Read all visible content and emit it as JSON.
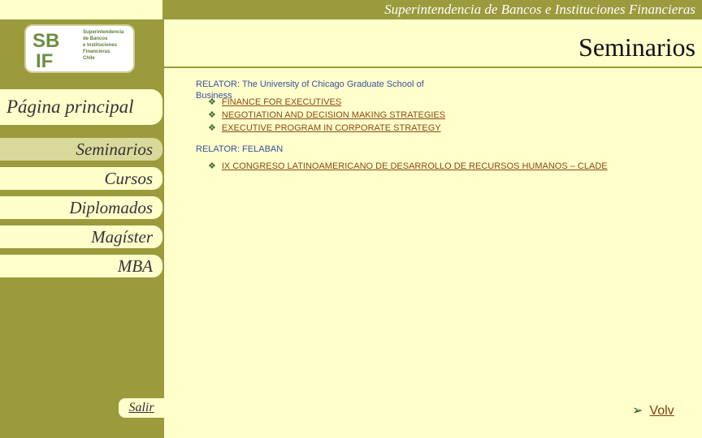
{
  "header": {
    "org_name": "Superintendencia de Bancos e Instituciones Financieras",
    "page_title": "Seminarios"
  },
  "logo": {
    "letters": "SBIF",
    "lines": [
      "Superintendencia",
      "de Bancos",
      "e Instituciones",
      "Financieras",
      "Chile"
    ]
  },
  "nav": {
    "main": "Página principal",
    "items": [
      "Seminarios",
      "Cursos",
      "Diplomados",
      "Magíster",
      "MBA"
    ],
    "active": "Seminarios",
    "salir": "Salir"
  },
  "content": {
    "groups": [
      {
        "relator": "RELATOR: The University of Chicago Graduate School of Business",
        "items": [
          "FINANCE FOR EXECUTIVES",
          "NEGOTIATION AND DECISION MAKING STRATEGIES",
          "EXECUTIVE PROGRAM IN CORPORATE STRATEGY"
        ]
      },
      {
        "relator": "RELATOR: FELABAN",
        "items": [
          "IX CONGRESO LATINOAMERICANO DE DESARROLLO DE RECURSOS HUMANOS – CLADE"
        ]
      }
    ]
  },
  "footer": {
    "volver": "Volv"
  },
  "colors": {
    "olive": "#9b9a3c",
    "cream": "#ffffcc",
    "link": "#8a4a10"
  }
}
